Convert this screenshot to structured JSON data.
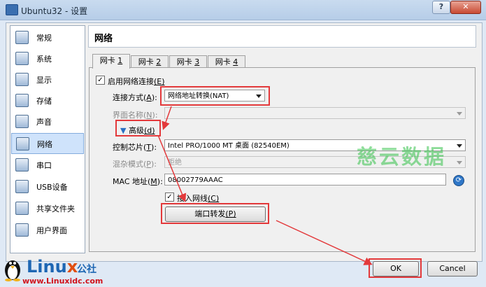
{
  "window": {
    "title": "Ubuntu32 - 设置",
    "help_label": "?",
    "close_label": "✕"
  },
  "sidebar": {
    "items": [
      {
        "label": "常规",
        "icon": "general-icon"
      },
      {
        "label": "系统",
        "icon": "system-icon"
      },
      {
        "label": "显示",
        "icon": "display-icon"
      },
      {
        "label": "存储",
        "icon": "storage-icon"
      },
      {
        "label": "声音",
        "icon": "audio-icon"
      },
      {
        "label": "网络",
        "icon": "network-icon",
        "selected": true
      },
      {
        "label": "串口",
        "icon": "serial-port-icon"
      },
      {
        "label": "USB设备",
        "icon": "usb-icon"
      },
      {
        "label": "共享文件夹",
        "icon": "shared-folder-icon"
      },
      {
        "label": "用户界面",
        "icon": "user-interface-icon"
      }
    ]
  },
  "page": {
    "title": "网络"
  },
  "tabs": [
    {
      "prefix": "网卡 ",
      "num": "1",
      "active": true
    },
    {
      "prefix": "网卡 ",
      "num": "2"
    },
    {
      "prefix": "网卡 ",
      "num": "3"
    },
    {
      "prefix": "网卡 ",
      "num": "4"
    }
  ],
  "adapter": {
    "enable_label": "启用网络连接",
    "enable_key": "(E)",
    "enable_checked": true,
    "attached_label": "连接方式(",
    "attached_key": "A",
    "attached_end": "):",
    "attached_value": "网络地址转换(NAT)",
    "name_label": "界面名称(",
    "name_key": "N",
    "name_end": "):",
    "name_value": "",
    "advanced_label": "高级",
    "advanced_key": "(d)",
    "chip_label": "控制芯片(",
    "chip_key": "T",
    "chip_end": "):",
    "chip_value": "Intel PRO/1000 MT 桌面 (82540EM)",
    "promisc_label": "混杂模式(",
    "promisc_key": "P",
    "promisc_end": "):",
    "promisc_value": "拒绝",
    "mac_label": "MAC 地址(",
    "mac_key": "M",
    "mac_end": "):",
    "mac_value": "08002779AAAC",
    "cable_label": "接入网线",
    "cable_key": "(C)",
    "cable_checked": true,
    "port_forward_label": "端口转发",
    "port_forward_key": "(P)"
  },
  "watermark": "慈云数据",
  "buttons": {
    "ok": "OK",
    "cancel": "Cancel"
  },
  "logo": {
    "main_a": "Linu",
    "main_b": "x",
    "sub": "公社",
    "url": "www.Linuxidc.com"
  },
  "colors": {
    "highlight_red": "#e3393b",
    "selection_blue": "#cfe3fb",
    "watermark_green": "#34c24a"
  }
}
